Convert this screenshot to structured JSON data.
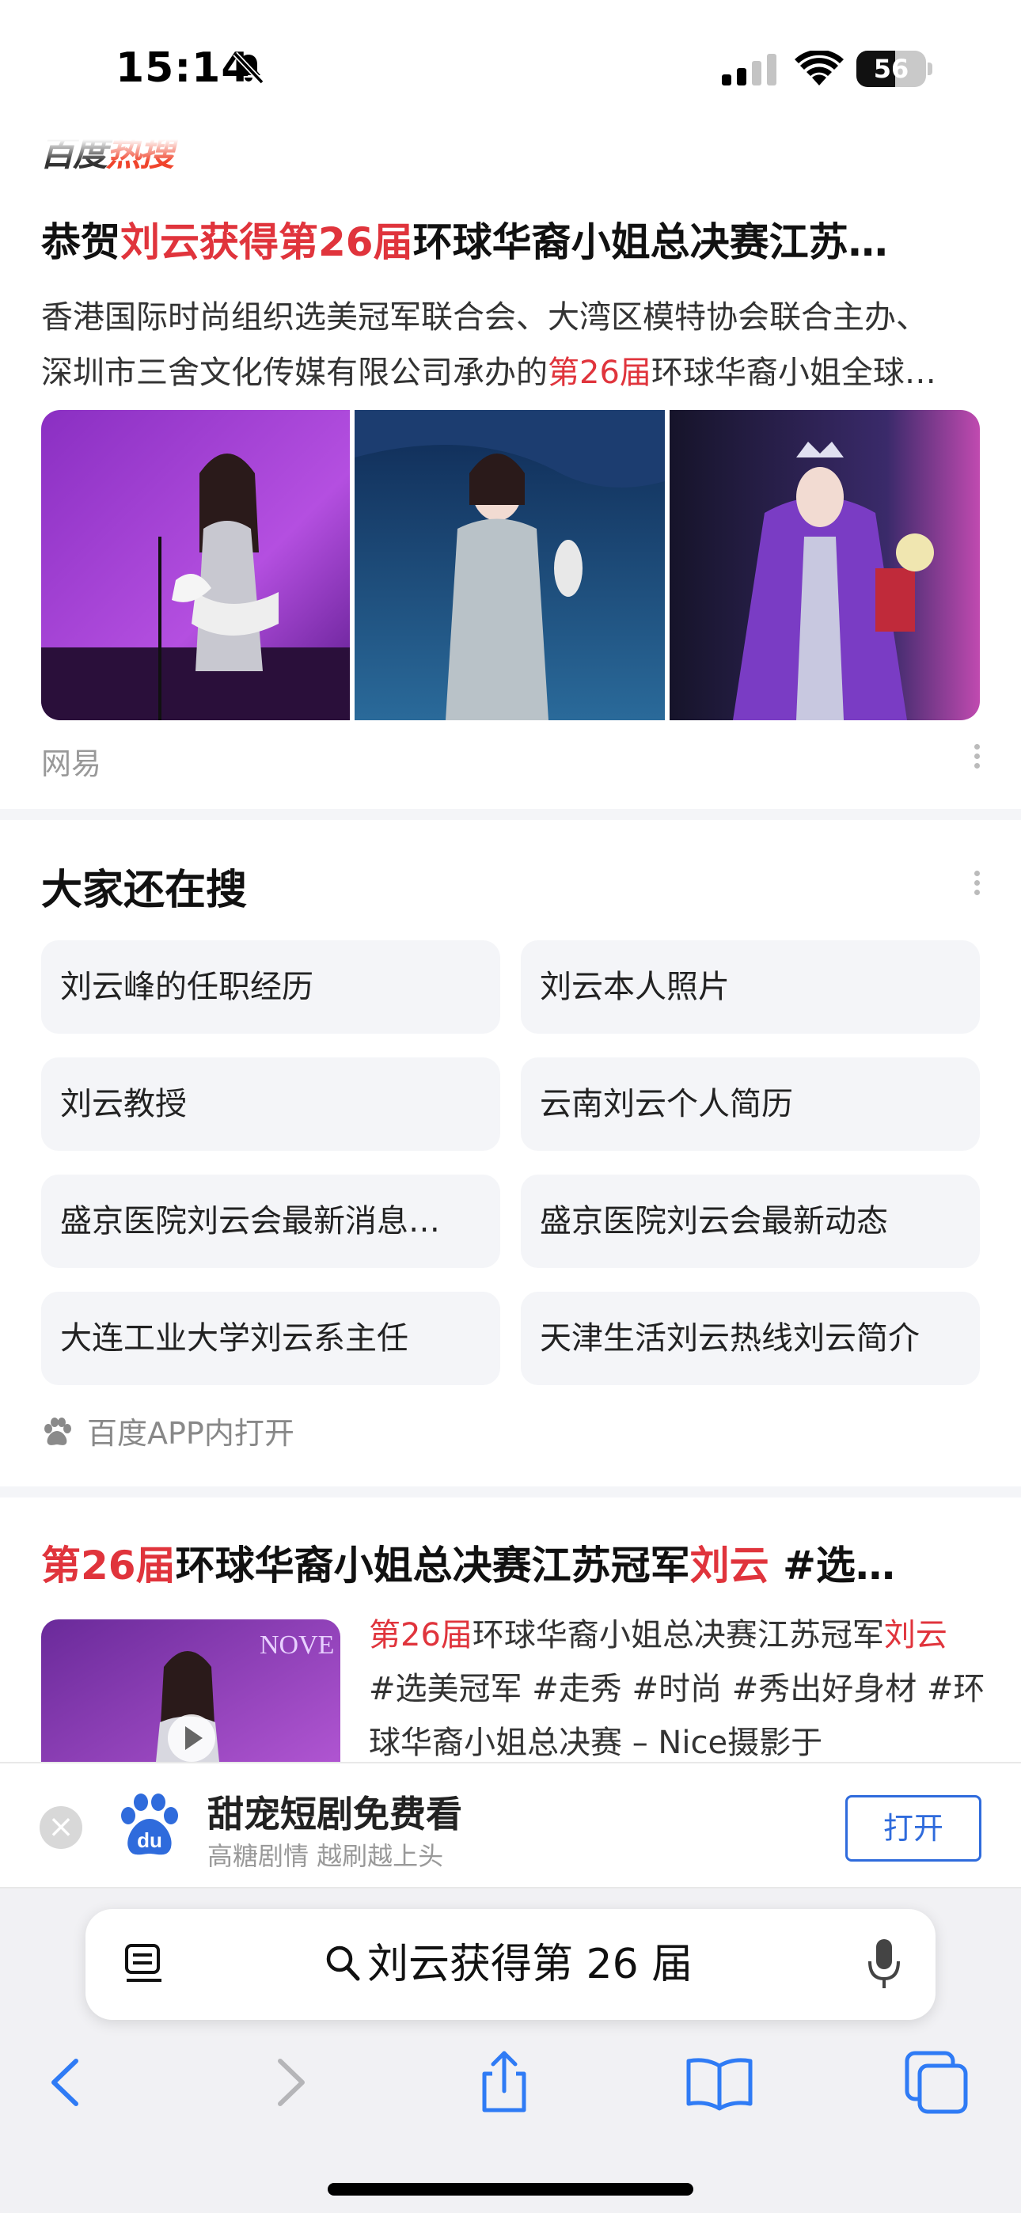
{
  "status_bar": {
    "time": "15:14",
    "battery": "56",
    "battery_level": 0.56
  },
  "brand": {
    "logo_text_a": "百度",
    "logo_text_b": "热搜"
  },
  "card1": {
    "title_pre": "恭贺",
    "title_hl": "刘云获得第26届",
    "title_post": "环球华裔小姐总决赛江苏…",
    "line1": "香港国际时尚组织选美冠军联合会、大湾区模特协会联合主办、",
    "line2_pre": "深圳市三舍文化传媒有限公司承办的",
    "line2_hl": "第26届",
    "line2_post": "环球华裔小姐全球…",
    "source": "网易"
  },
  "related": {
    "title": "大家还在搜",
    "items": [
      "刘云峰的任职经历",
      "刘云本人照片",
      "刘云教授",
      "云南刘云个人简历",
      "盛京医院刘云会最新消息…",
      "盛京医院刘云会最新动态",
      "大连工业大学刘云系主任",
      "天津生活刘云热线刘云简介"
    ],
    "open_app": "百度APP内打开"
  },
  "card3": {
    "title_hl1": "第26届",
    "title_mid": "环球华裔小姐总决赛江苏冠军",
    "title_hl2": "刘云",
    "title_post": " #选…",
    "thumb_text": "NOVE",
    "l1_hl": "第26届",
    "l1_mid": "环球华裔小姐总决赛江苏冠军",
    "l1_hl2": "刘云",
    "l2": "#选美冠军 #走秀 #时尚 #秀出好身材 #环",
    "l3": "球华裔小姐总决赛 – Nice摄影于"
  },
  "banner": {
    "title": "甜宠短剧免费看",
    "subtitle": "高糖剧情 越刷越上头",
    "open_label": "打开",
    "close_glyph": "×"
  },
  "safari": {
    "url_text": "刘云获得第 26 届"
  },
  "colors": {
    "highlight": "#e0343c",
    "baidu_blue": "#2f6bdc",
    "chip_bg": "#f4f5f8"
  }
}
